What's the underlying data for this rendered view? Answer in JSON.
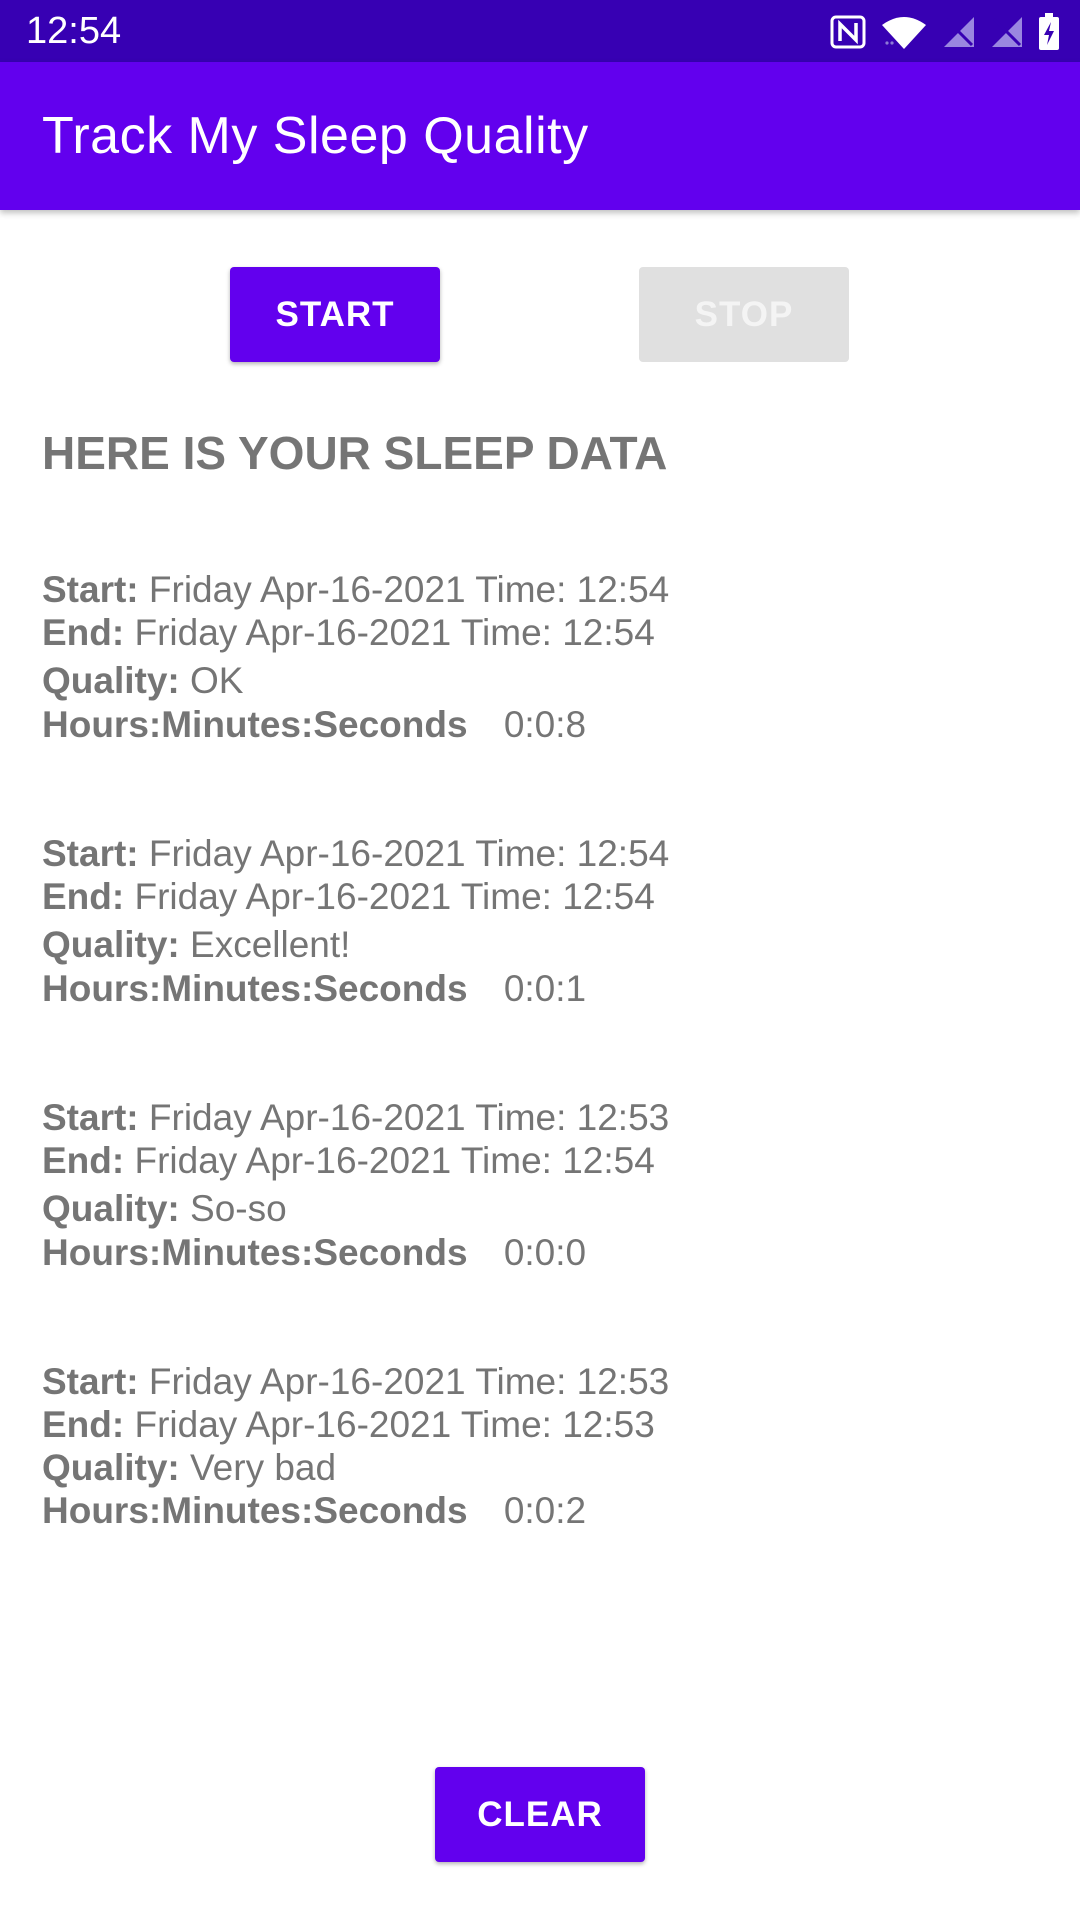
{
  "status_bar": {
    "time": "12:54",
    "icons": [
      "nfc-icon",
      "wifi-icon",
      "no-signal-icon",
      "no-signal-icon",
      "battery-charging-icon"
    ]
  },
  "app_bar": {
    "title": "Track My Sleep Quality",
    "color": "#6200ee"
  },
  "controls": {
    "start_label": "START",
    "stop_label": "STOP",
    "stop_enabled": false,
    "clear_label": "CLEAR"
  },
  "heading": "HERE IS YOUR SLEEP DATA",
  "labels": {
    "start": "Start:",
    "end": "End:",
    "quality": "Quality:",
    "duration": "Hours:Minutes:Seconds"
  },
  "entries": [
    {
      "start": "Friday Apr-16-2021 Time: 12:54",
      "end": "Friday Apr-16-2021 Time: 12:54",
      "quality": "OK",
      "duration": "0:0:8"
    },
    {
      "start": "Friday Apr-16-2021 Time: 12:54",
      "end": "Friday Apr-16-2021 Time: 12:54",
      "quality": "Excellent!",
      "duration": "0:0:1"
    },
    {
      "start": "Friday Apr-16-2021 Time: 12:53",
      "end": "Friday Apr-16-2021 Time: 12:54",
      "quality": "So-so",
      "duration": "0:0:0"
    },
    {
      "start": "Friday Apr-16-2021 Time: 12:53",
      "end": "Friday Apr-16-2021 Time: 12:53",
      "quality": "Very bad",
      "duration": "0:0:2"
    }
  ]
}
